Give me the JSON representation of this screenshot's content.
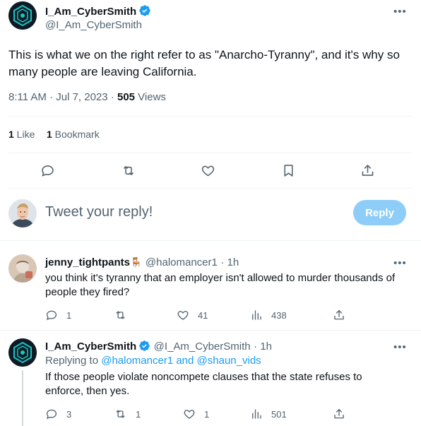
{
  "main_tweet": {
    "display_name": "I_Am_CyberSmith",
    "handle": "@I_Am_CyberSmith",
    "text": "This is what we on the right refer to as \"Anarcho-Tyranny\", and it's why so many people are leaving California.",
    "time": "8:11 AM · Jul 7, 2023 · ",
    "views_count": "505",
    "views_label": " Views",
    "likes_count": "1",
    "likes_label": " Like",
    "bookmarks_count": "1",
    "bookmarks_label": " Bookmark"
  },
  "composer": {
    "placeholder": "Tweet your reply!",
    "reply_label": "Reply"
  },
  "replies": [
    {
      "display_name": "jenny_tightpants",
      "emoji": "🪑",
      "handle": "@halomancer1",
      "time": "· 1h",
      "text": "you think it's tyranny that an employer isn't allowed to murder thousands of people they fired?",
      "reply_count": "1",
      "retweet_count": "",
      "like_count": "41",
      "view_count": "438"
    },
    {
      "display_name": "I_Am_CyberSmith",
      "handle": "@I_Am_CyberSmith",
      "time": "· 1h",
      "replying_prefix": "Replying to ",
      "replying_user1": "@halomancer1",
      "replying_and": " and ",
      "replying_user2": "@shaun_vids",
      "text": "If those people violate noncompete clauses that the state refuses to enforce, then yes.",
      "reply_count": "3",
      "retweet_count": "1",
      "like_count": "1",
      "view_count": "501"
    }
  ],
  "more_label": "•••",
  "colors": {
    "accent": "#1d9bf0",
    "reply_button": "#8ecdf8",
    "muted": "#536471",
    "divider": "#eff3f4"
  },
  "icons": [
    "verified-badge-icon",
    "more-icon",
    "reply-icon",
    "retweet-icon",
    "like-icon",
    "bookmark-icon",
    "share-icon",
    "views-icon"
  ]
}
